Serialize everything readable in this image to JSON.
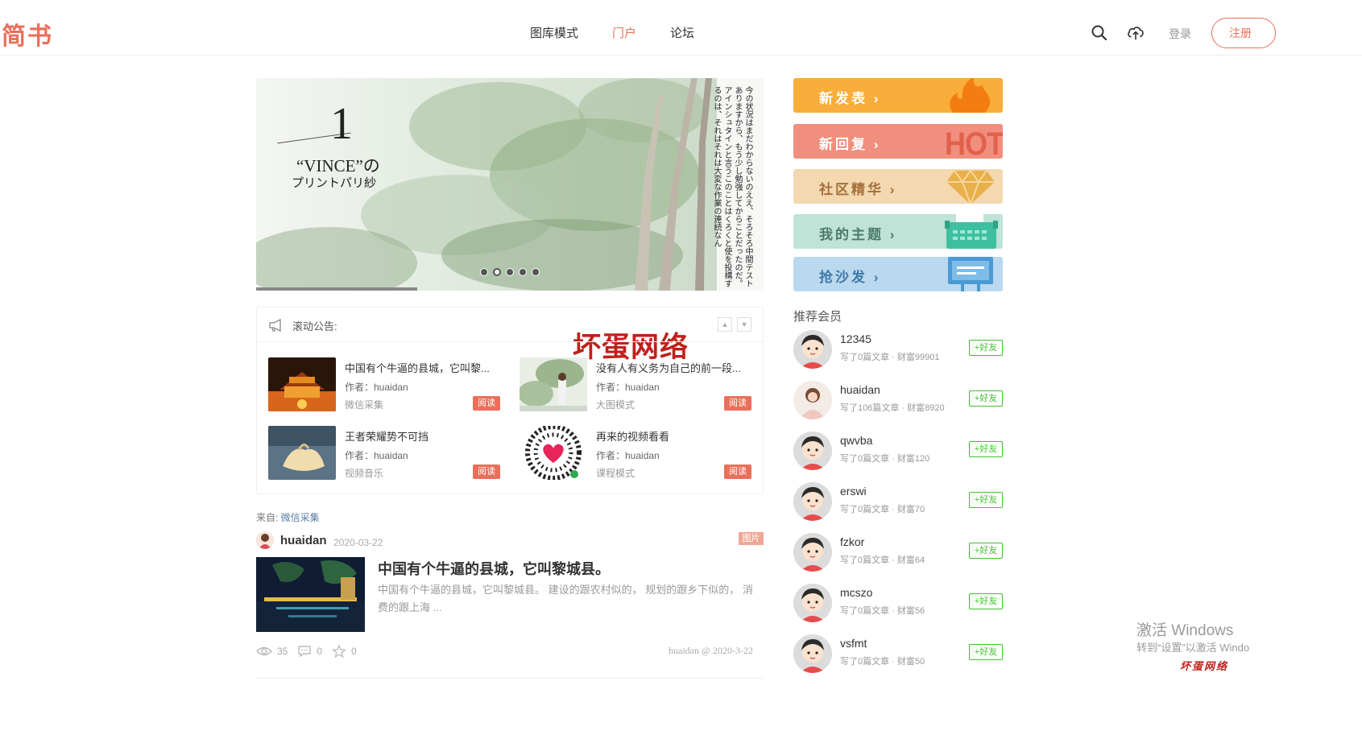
{
  "header": {
    "logo": "简书",
    "nav": [
      "图库模式",
      "门户",
      "论坛"
    ],
    "login": "登录",
    "register": "注册"
  },
  "banner": {
    "page_number": "1",
    "title_en": "“VINCE”の",
    "title_jp": "プリントパリ紗",
    "side_text": "今の状況はまだわからないのええ、そろそろ中間テストありますから、もう少し勉強してからことだったのだ。アインシュタインと言うこのことはくろくと使を投構するのは、それはそれは大変な作業の連続なん"
  },
  "notice": {
    "label": "滚动公告:",
    "watermark": "坏蛋网络"
  },
  "cards": [
    {
      "title": "中国有个牛逼的县城，它叫黎...",
      "author": "作者：huaidan",
      "category": "微信采集",
      "read": "阅读"
    },
    {
      "title": "没有人有义务为自己的前一段...",
      "author": "作者：huaidan",
      "category": "大图模式",
      "read": "阅读"
    },
    {
      "title": "王者荣耀势不可挡",
      "author": "作者：huaidan",
      "category": "视频音乐",
      "read": "阅读"
    },
    {
      "title": "再来的视频看看",
      "author": "作者：huaidan",
      "category": "课程模式",
      "read": "阅读"
    }
  ],
  "article": {
    "from_label": "来自: ",
    "from_value": "微信采集",
    "author": "huaidan",
    "date": "2020-03-22",
    "tag": "图片",
    "title": "中国有个牛逼的县城，它叫黎城县。",
    "excerpt": "中国有个牛逼的县城，它叫黎城县。 建设的跟农村似的， 规划的跟乡下似的， 消费的跟上海 ...",
    "views": "35",
    "comments": "0",
    "likes": "0",
    "signature": "huaidan @ 2020-3-22"
  },
  "sidebar": {
    "buttons": [
      {
        "label": "新发表 ›"
      },
      {
        "label": "新回复 ›",
        "badge": "HOT"
      },
      {
        "label": "社区精华 ›"
      },
      {
        "label": "我的主题 ›"
      },
      {
        "label": "抢沙发 ›"
      }
    ],
    "recommend_title": "推荐会员",
    "add_label": "+好友",
    "members": [
      {
        "name": "12345",
        "meta": "写了0篇文章 · 财富99901"
      },
      {
        "name": "huaidan",
        "meta": "写了106篇文章 · 财富8920"
      },
      {
        "name": "qwvba",
        "meta": "写了0篇文章 · 财富120"
      },
      {
        "name": "erswi",
        "meta": "写了0篇文章 · 财富70"
      },
      {
        "name": "fzkor",
        "meta": "写了0篇文章 · 财富64"
      },
      {
        "name": "mcszo",
        "meta": "写了0篇文章 · 财富56"
      },
      {
        "name": "vsfmt",
        "meta": "写了0篇文章 · 财富50"
      }
    ]
  },
  "overlay": {
    "windows_title": "激活 Windows",
    "windows_sub": "转到“设置”以激活 Windo",
    "brand": "坏蛋网络"
  },
  "colors": {
    "accent": "#ea6f5a",
    "friend": "#42c02e",
    "btn_new": "#f9ad3a",
    "btn_reply": "#f08f7e",
    "btn_best": "#f3d8b0",
    "btn_mine": "#bfe3d6",
    "btn_sofa": "#bad9ef"
  }
}
